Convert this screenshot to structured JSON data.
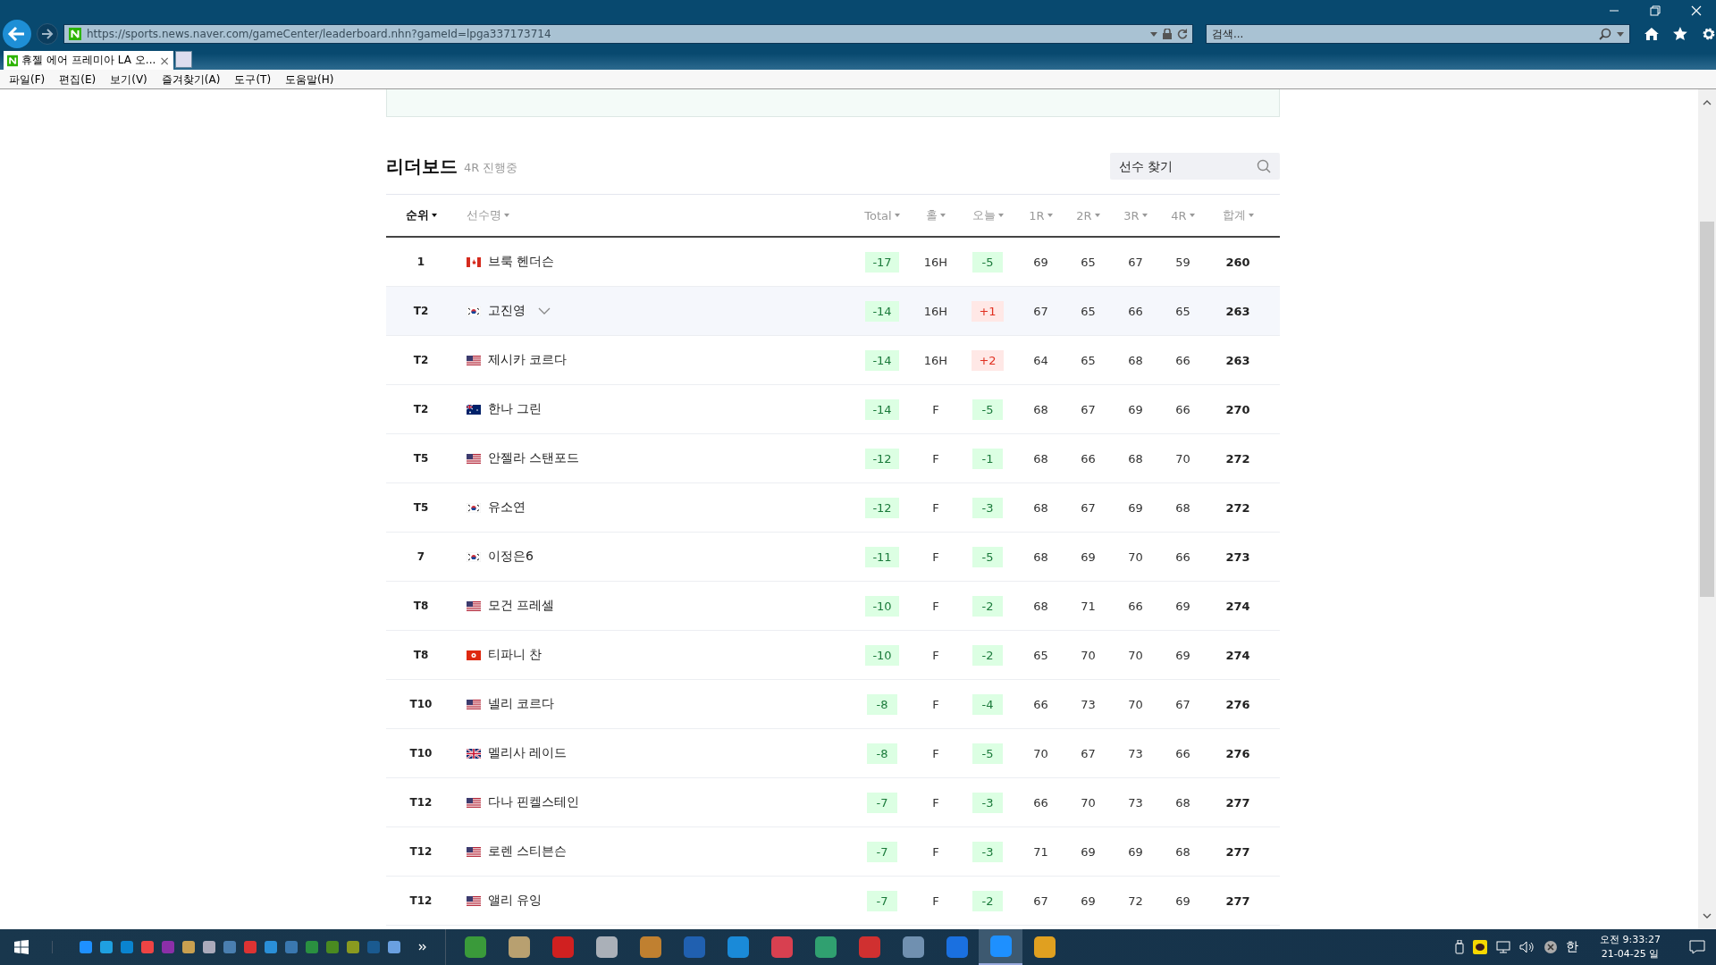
{
  "browser": {
    "url": "https://sports.news.naver.com/gameCenter/leaderboard.nhn?gameId=lpga337173714",
    "search_placeholder": "검색...",
    "tabs": [
      {
        "title": "휴젤 에어 프레미아 LA 오...",
        "close": "×",
        "selected": true
      }
    ],
    "menu": [
      "파일(F)",
      "편집(E)",
      "보기(V)",
      "즐겨찾기(A)",
      "도구(T)",
      "도움말(H)"
    ]
  },
  "leaderboard": {
    "title": "리더보드",
    "subtitle": "4R 진행중",
    "search": {
      "placeholder": "선수 찾기"
    },
    "columns": [
      {
        "label": "순위",
        "selected": true
      },
      {
        "label": "선수명",
        "selected": false
      },
      {
        "label": "Total",
        "selected": false
      },
      {
        "label": "홀",
        "selected": false
      },
      {
        "label": "오늘",
        "selected": false
      },
      {
        "label": "1R",
        "selected": false
      },
      {
        "label": "2R",
        "selected": false
      },
      {
        "label": "3R",
        "selected": false
      },
      {
        "label": "4R",
        "selected": false
      },
      {
        "label": "합계",
        "selected": false
      }
    ],
    "rows": [
      {
        "rank": "1",
        "flag": {
          "kind": "ca"
        },
        "name": "브룩 헨더슨",
        "total": "-17",
        "hole": "16H",
        "today": "-5",
        "over_par": false,
        "r1": "69",
        "r2": "65",
        "r3": "67",
        "r4": "59",
        "sum": "260",
        "highlighted": false
      },
      {
        "rank": "T2",
        "flag": {
          "kind": "kr"
        },
        "name": "고진영",
        "total": "-14",
        "hole": "16H",
        "today": "+1",
        "over_par": true,
        "r1": "67",
        "r2": "65",
        "r3": "66",
        "r4": "65",
        "sum": "263",
        "highlighted": true
      },
      {
        "rank": "T2",
        "flag": {
          "kind": "us"
        },
        "name": "제시카 코르다",
        "total": "-14",
        "hole": "16H",
        "today": "+2",
        "over_par": true,
        "r1": "64",
        "r2": "65",
        "r3": "68",
        "r4": "66",
        "sum": "263",
        "highlighted": false
      },
      {
        "rank": "T2",
        "flag": {
          "kind": "au"
        },
        "name": "한나 그린",
        "total": "-14",
        "hole": "F",
        "today": "-5",
        "over_par": false,
        "r1": "68",
        "r2": "67",
        "r3": "69",
        "r4": "66",
        "sum": "270",
        "highlighted": false
      },
      {
        "rank": "T5",
        "flag": {
          "kind": "us"
        },
        "name": "안젤라 스탠포드",
        "total": "-12",
        "hole": "F",
        "today": "-1",
        "over_par": false,
        "r1": "68",
        "r2": "66",
        "r3": "68",
        "r4": "70",
        "sum": "272",
        "highlighted": false
      },
      {
        "rank": "T5",
        "flag": {
          "kind": "kr"
        },
        "name": "유소연",
        "total": "-12",
        "hole": "F",
        "today": "-3",
        "over_par": false,
        "r1": "68",
        "r2": "67",
        "r3": "69",
        "r4": "68",
        "sum": "272",
        "highlighted": false
      },
      {
        "rank": "7",
        "flag": {
          "kind": "kr"
        },
        "name": "이정은6",
        "total": "-11",
        "hole": "F",
        "today": "-5",
        "over_par": false,
        "r1": "68",
        "r2": "69",
        "r3": "70",
        "r4": "66",
        "sum": "273",
        "highlighted": false
      },
      {
        "rank": "T8",
        "flag": {
          "kind": "us"
        },
        "name": "모건 프레셀",
        "total": "-10",
        "hole": "F",
        "today": "-2",
        "over_par": false,
        "r1": "68",
        "r2": "71",
        "r3": "66",
        "r4": "69",
        "sum": "274",
        "highlighted": false
      },
      {
        "rank": "T8",
        "flag": {
          "kind": "hk"
        },
        "name": "티파니 찬",
        "total": "-10",
        "hole": "F",
        "today": "-2",
        "over_par": false,
        "r1": "65",
        "r2": "70",
        "r3": "70",
        "r4": "69",
        "sum": "274",
        "highlighted": false
      },
      {
        "rank": "T10",
        "flag": {
          "kind": "us"
        },
        "name": "넬리 코르다",
        "total": "-8",
        "hole": "F",
        "today": "-4",
        "over_par": false,
        "r1": "66",
        "r2": "73",
        "r3": "70",
        "r4": "67",
        "sum": "276",
        "highlighted": false
      },
      {
        "rank": "T10",
        "flag": {
          "kind": "gb"
        },
        "name": "멜리사 레이드",
        "total": "-8",
        "hole": "F",
        "today": "-5",
        "over_par": false,
        "r1": "70",
        "r2": "67",
        "r3": "73",
        "r4": "66",
        "sum": "276",
        "highlighted": false
      },
      {
        "rank": "T12",
        "flag": {
          "kind": "us"
        },
        "name": "다나 핀켈스테인",
        "total": "-7",
        "hole": "F",
        "today": "-3",
        "over_par": false,
        "r1": "66",
        "r2": "70",
        "r3": "73",
        "r4": "68",
        "sum": "277",
        "highlighted": false
      },
      {
        "rank": "T12",
        "flag": {
          "kind": "us"
        },
        "name": "로렌 스티븐슨",
        "total": "-7",
        "hole": "F",
        "today": "-3",
        "over_par": false,
        "r1": "71",
        "r2": "69",
        "r3": "69",
        "r4": "68",
        "sum": "277",
        "highlighted": false
      },
      {
        "rank": "T12",
        "flag": {
          "kind": "us"
        },
        "name": "앨리 유잉",
        "total": "-7",
        "hole": "F",
        "today": "-2",
        "over_par": false,
        "r1": "67",
        "r2": "69",
        "r3": "72",
        "r4": "69",
        "sum": "277",
        "highlighted": false
      }
    ]
  },
  "taskbar": {
    "apps": [
      {
        "selected": false
      },
      {
        "selected": false
      },
      {
        "selected": false
      },
      {
        "selected": false
      },
      {
        "selected": false
      },
      {
        "selected": false
      },
      {
        "selected": false
      },
      {
        "selected": false
      },
      {
        "selected": false
      },
      {
        "selected": false
      },
      {
        "selected": false
      },
      {
        "selected": false
      },
      {
        "selected": true
      },
      {
        "selected": false
      }
    ],
    "ime": "한",
    "time": "오전 9:33:27",
    "date": "21-04-25 일"
  }
}
